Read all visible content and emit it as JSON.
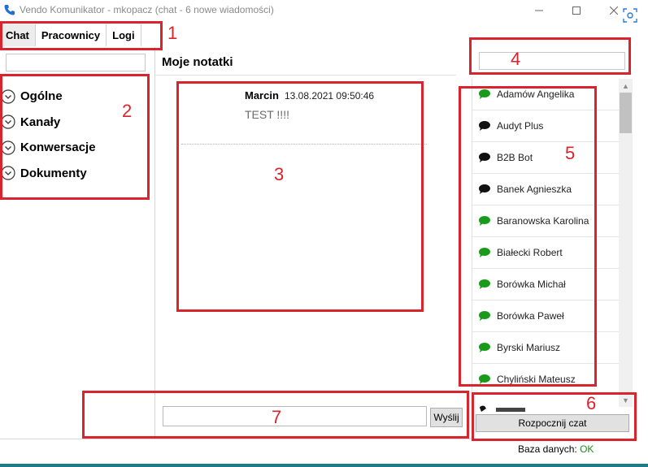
{
  "window": {
    "title": "Vendo Komunikator - mkopacz (chat - 6 nowe wiadomości)"
  },
  "tabs": [
    {
      "label": "Chat",
      "active": true
    },
    {
      "label": "Pracownicy",
      "active": false
    },
    {
      "label": "Logi",
      "active": false
    }
  ],
  "left_panel": {
    "search_value": "",
    "nav": [
      {
        "label": "Ogólne"
      },
      {
        "label": "Kanały"
      },
      {
        "label": "Konwersacje"
      },
      {
        "label": "Dokumenty"
      }
    ]
  },
  "center": {
    "header": "Moje notatki",
    "message": {
      "author": "Marcin",
      "timestamp": "13.08.2021 09:50:46",
      "text": "TEST !!!!"
    },
    "input_value": "",
    "send_label": "Wyślij"
  },
  "right_panel": {
    "search_value": "",
    "users": [
      {
        "name": "Adamów Angelika",
        "status": "online"
      },
      {
        "name": "Audyt Plus",
        "status": "offline"
      },
      {
        "name": "B2B Bot",
        "status": "offline"
      },
      {
        "name": "Banek Agnieszka",
        "status": "offline"
      },
      {
        "name": "Baranowska Karolina",
        "status": "online"
      },
      {
        "name": "Białecki Robert",
        "status": "online"
      },
      {
        "name": "Borówka Michał",
        "status": "online"
      },
      {
        "name": "Borówka Paweł",
        "status": "online"
      },
      {
        "name": "Byrski Mariusz",
        "status": "online"
      },
      {
        "name": "Chyliński Mateusz",
        "status": "online"
      }
    ],
    "start_chat_label": "Rozpocznij czat",
    "db_label": "Baza danych:",
    "db_status": "OK"
  },
  "annotations": [
    "1",
    "2",
    "3",
    "4",
    "5",
    "6",
    "7"
  ],
  "colors": {
    "online": "#1a9a1a",
    "offline": "#111111",
    "annotation": "#d9232d",
    "db_ok": "#1c8a1c"
  },
  "icons": {
    "app": "phone-icon",
    "nav": "chevron-down-circle-icon",
    "user": "chat-bubble-icon"
  }
}
